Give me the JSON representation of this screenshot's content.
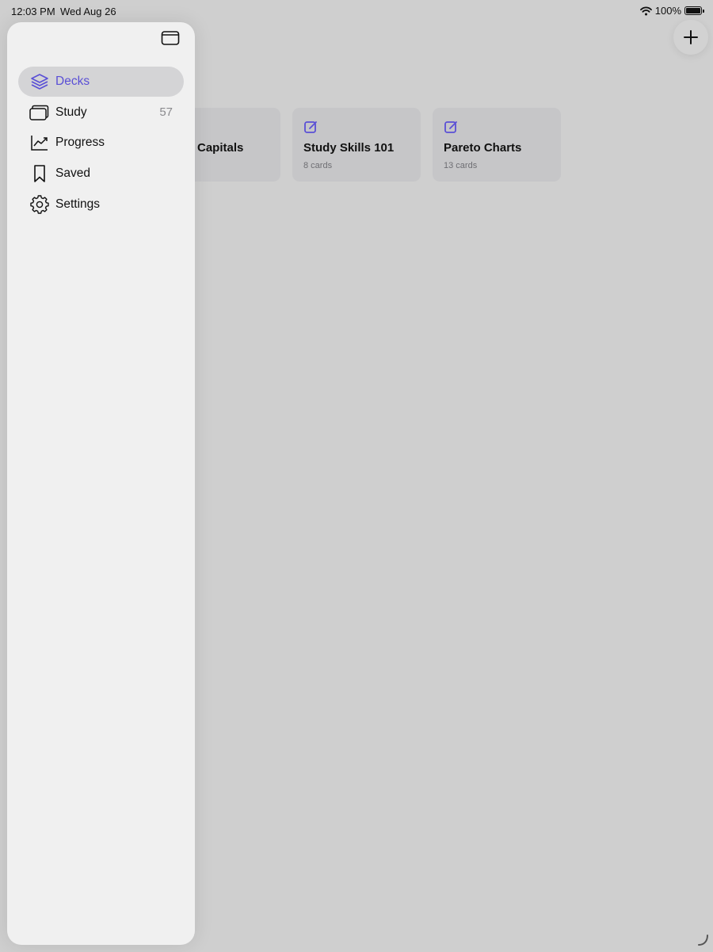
{
  "status_bar": {
    "time": "12:03 PM",
    "date": "Wed Aug 26",
    "battery_percent": "100%",
    "battery_level": 1.0
  },
  "toolbar": {
    "add_icon": "plus-icon"
  },
  "decks": [
    {
      "title": "",
      "count": "",
      "icon": "edit-icon"
    },
    {
      "title": "Capitals",
      "count": "",
      "icon": "edit-icon"
    },
    {
      "title": "Study Skills 101",
      "count": "8 cards",
      "icon": "edit-icon"
    },
    {
      "title": "Pareto Charts",
      "count": "13 cards",
      "icon": "edit-icon"
    }
  ],
  "sidebar": {
    "toggle_icon": "sidebar-toggle-icon",
    "items": [
      {
        "label": "Decks",
        "icon": "stack-icon",
        "selected": true,
        "count": ""
      },
      {
        "label": "Study",
        "icon": "cards-icon",
        "selected": false,
        "count": "57"
      },
      {
        "label": "Progress",
        "icon": "chart-icon",
        "selected": false,
        "count": ""
      },
      {
        "label": "Saved",
        "icon": "bookmark-icon",
        "selected": false,
        "count": ""
      },
      {
        "label": "Settings",
        "icon": "gear-icon",
        "selected": false,
        "count": ""
      }
    ]
  },
  "colors": {
    "accent": "#5a4fd6",
    "background": "#cfcfcf",
    "sidebar_background": "#f0f0f0",
    "selected_row": "#d4d4d6"
  }
}
